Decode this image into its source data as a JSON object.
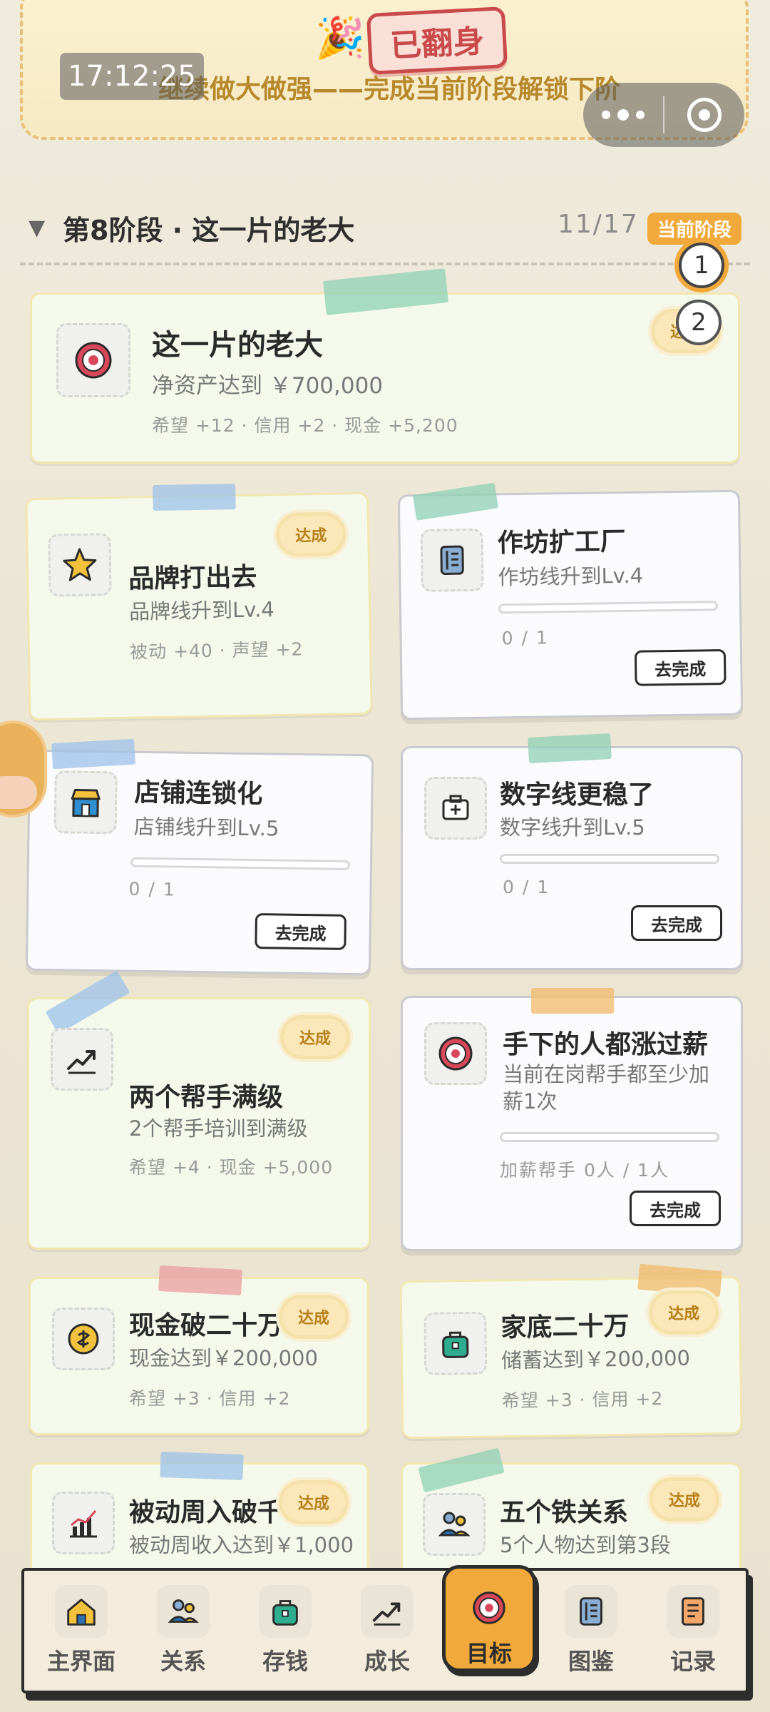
{
  "banner": {
    "badge": "已翻身",
    "subtitle": "继续做大做强——完成当前阶段解锁下阶",
    "time": "17:12:25"
  },
  "stage": {
    "title": "第8阶段 · 这一片的老大",
    "count": "11/17",
    "current_tag": "当前阶段",
    "markers": [
      "1",
      "2"
    ]
  },
  "featured": {
    "title": "这一片的老大",
    "desc": "净资产达到 ￥700,000",
    "reward": "希望 +12 · 信用 +2 · 现金 +5,200",
    "badge": "达成"
  },
  "goals": [
    {
      "title": "品牌打出去",
      "desc": "品牌线升到Lv.4",
      "reward": "被动 +40 · 声望 +2",
      "badge": "达成"
    },
    {
      "title": "作坊扩工厂",
      "desc": "作坊线升到Lv.4",
      "progress": "0 / 1",
      "button": "去完成"
    },
    {
      "title": "店铺连锁化",
      "desc": "店铺线升到Lv.5",
      "progress": "0 / 1",
      "button": "去完成"
    },
    {
      "title": "数字线更稳了",
      "desc": "数字线升到Lv.5",
      "progress": "0 / 1",
      "button": "去完成"
    },
    {
      "title": "两个帮手满级",
      "desc": "2个帮手培训到满级",
      "reward": "希望 +4 · 现金 +5,000",
      "badge": "达成"
    },
    {
      "title": "手下的人都涨过薪",
      "desc": "当前在岗帮手都至少加薪1次",
      "progress": "加薪帮手 0人 / 1人",
      "button": "去完成"
    },
    {
      "title": "现金破二十万",
      "desc": "现金达到￥200,000",
      "reward": "希望 +3 · 信用 +2",
      "badge": "达成"
    },
    {
      "title": "家底二十万",
      "desc": "储蓄达到￥200,000",
      "reward": "希望 +3 · 信用 +2",
      "badge": "达成"
    },
    {
      "title": "被动周入破千",
      "desc": "被动周收入达到￥1,000",
      "badge": "达成"
    },
    {
      "title": "五个铁关系",
      "desc": "5个人物达到第3段",
      "badge": "达成"
    }
  ],
  "nav": [
    {
      "label": "主界面",
      "icon": "home-icon"
    },
    {
      "label": "关系",
      "icon": "people-icon"
    },
    {
      "label": "存钱",
      "icon": "bag-icon"
    },
    {
      "label": "成长",
      "icon": "growth-icon"
    },
    {
      "label": "目标",
      "icon": "target-icon",
      "active": true
    },
    {
      "label": "图鉴",
      "icon": "book-icon"
    },
    {
      "label": "记录",
      "icon": "record-icon"
    }
  ],
  "colors": {
    "accent": "#f0a93a",
    "done_badge": "#fbe7b8",
    "red_badge": "#c94a4a",
    "banner_text": "#b7892c"
  }
}
